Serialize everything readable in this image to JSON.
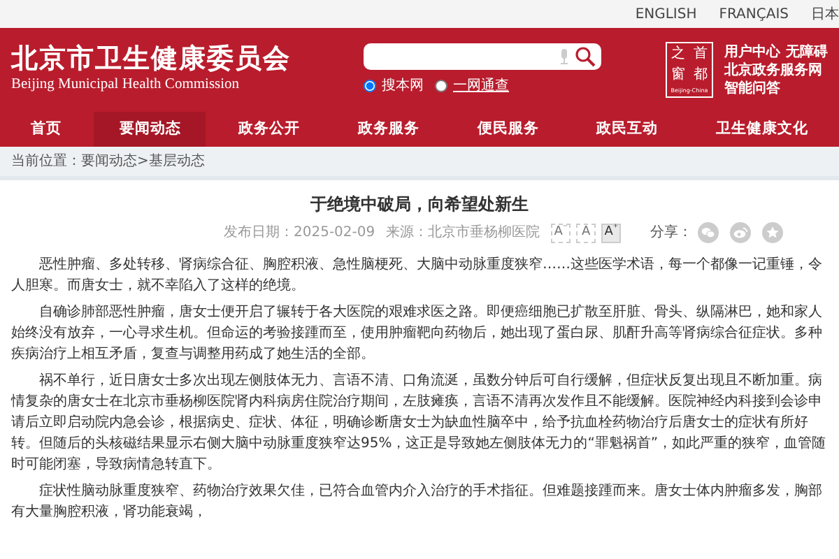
{
  "top_links": [
    "ENGLISH",
    "FRANÇAIS",
    "日本"
  ],
  "header": {
    "title": "北京市卫生健康委员会",
    "subtitle": "Beijing Municipal Health Commission",
    "search": {
      "scopes": [
        {
          "label": "搜本网",
          "selected": true
        },
        {
          "label": "一网通查",
          "selected": false
        }
      ]
    },
    "portal_logo": {
      "chars": [
        "之",
        "首",
        "窗",
        "都"
      ],
      "caption": "Beijing-China"
    },
    "portal_links": [
      [
        "用户中心",
        "无障碍"
      ],
      [
        "北京政务服务网"
      ],
      [
        "智能问答"
      ]
    ]
  },
  "nav": [
    {
      "label": "首页",
      "selected": false
    },
    {
      "label": "要闻动态",
      "selected": true
    },
    {
      "label": "政务公开",
      "selected": false
    },
    {
      "label": "政务服务",
      "selected": false
    },
    {
      "label": "便民服务",
      "selected": false
    },
    {
      "label": "政民互动",
      "selected": false
    },
    {
      "label": "卫生健康文化",
      "selected": false
    }
  ],
  "breadcrumb": {
    "prefix": "当前位置：",
    "items": [
      "要闻动态",
      "基层动态"
    ],
    "separator": ">"
  },
  "article": {
    "title": "于绝境中破局，向希望处新生",
    "date": "发布日期：2025-02-09",
    "source": "来源：北京市垂杨柳医院",
    "font_sizes": [
      {
        "label": "A",
        "sign": "⁻",
        "selected": false
      },
      {
        "label": "A",
        "selected": false
      },
      {
        "label": "A",
        "sign": "⁺",
        "selected": true
      }
    ],
    "share_label": "分享：",
    "share": [
      {
        "kind": "wechat"
      },
      {
        "kind": "weibo"
      },
      {
        "kind": "favorite"
      }
    ],
    "paragraphs": [
      "恶性肿瘤、多处转移、肾病综合征、胸腔积液、急性脑梗死、大脑中动脉重度狭窄……这些医学术语，每一个都像一记重锤，令人胆寒。而唐女士，就不幸陷入了这样的绝境。",
      "自确诊肺部恶性肿瘤，唐女士便开启了辗转于各大医院的艰难求医之路。即便癌细胞已扩散至肝脏、骨头、纵隔淋巴，她和家人始终没有放弃，一心寻求生机。但命运的考验接踵而至，使用肿瘤靶向药物后，她出现了蛋白尿、肌酐升高等肾病综合征症状。多种疾病治疗上相互矛盾，复查与调整用药成了她生活的全部。",
      "祸不单行，近日唐女士多次出现左侧肢体无力、言语不清、口角流涎，虽数分钟后可自行缓解，但症状反复出现且不断加重。病情复杂的唐女士在北京市垂杨柳医院肾内科病房住院治疗期间，左肢瘫痪，言语不清再次发作且不能缓解。医院神经内科接到会诊申请后立即启动院内急会诊，根据病史、症状、体征，明确诊断唐女士为缺血性脑卒中，给予抗血栓药物治疗后唐女士的症状有所好转。但随后的头核磁结果显示右侧大脑中动脉重度狭窄达95%，这正是导致她左侧肢体无力的“罪魁祸首”，如此严重的狭窄，血管随时可能闭塞，导致病情急转直下。",
      "症状性脑动脉重度狭窄、药物治疗效果欠佳，已符合血管内介入治疗的手术指征。但难题接踵而来。唐女士体内肿瘤多发，胸部有大量胸腔积液，肾功能衰竭，"
    ]
  }
}
